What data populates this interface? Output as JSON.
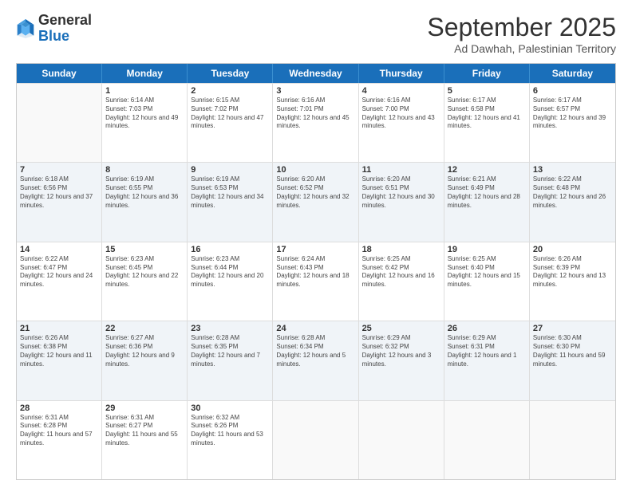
{
  "header": {
    "logo_general": "General",
    "logo_blue": "Blue",
    "month_title": "September 2025",
    "subtitle": "Ad Dawhah, Palestinian Territory"
  },
  "days": [
    "Sunday",
    "Monday",
    "Tuesday",
    "Wednesday",
    "Thursday",
    "Friday",
    "Saturday"
  ],
  "weeks": [
    [
      {
        "day": "",
        "sunrise": "",
        "sunset": "",
        "daylight": ""
      },
      {
        "day": "1",
        "sunrise": "6:14 AM",
        "sunset": "7:03 PM",
        "daylight": "12 hours and 49 minutes."
      },
      {
        "day": "2",
        "sunrise": "6:15 AM",
        "sunset": "7:02 PM",
        "daylight": "12 hours and 47 minutes."
      },
      {
        "day": "3",
        "sunrise": "6:16 AM",
        "sunset": "7:01 PM",
        "daylight": "12 hours and 45 minutes."
      },
      {
        "day": "4",
        "sunrise": "6:16 AM",
        "sunset": "7:00 PM",
        "daylight": "12 hours and 43 minutes."
      },
      {
        "day": "5",
        "sunrise": "6:17 AM",
        "sunset": "6:58 PM",
        "daylight": "12 hours and 41 minutes."
      },
      {
        "day": "6",
        "sunrise": "6:17 AM",
        "sunset": "6:57 PM",
        "daylight": "12 hours and 39 minutes."
      }
    ],
    [
      {
        "day": "7",
        "sunrise": "6:18 AM",
        "sunset": "6:56 PM",
        "daylight": "12 hours and 37 minutes."
      },
      {
        "day": "8",
        "sunrise": "6:19 AM",
        "sunset": "6:55 PM",
        "daylight": "12 hours and 36 minutes."
      },
      {
        "day": "9",
        "sunrise": "6:19 AM",
        "sunset": "6:53 PM",
        "daylight": "12 hours and 34 minutes."
      },
      {
        "day": "10",
        "sunrise": "6:20 AM",
        "sunset": "6:52 PM",
        "daylight": "12 hours and 32 minutes."
      },
      {
        "day": "11",
        "sunrise": "6:20 AM",
        "sunset": "6:51 PM",
        "daylight": "12 hours and 30 minutes."
      },
      {
        "day": "12",
        "sunrise": "6:21 AM",
        "sunset": "6:49 PM",
        "daylight": "12 hours and 28 minutes."
      },
      {
        "day": "13",
        "sunrise": "6:22 AM",
        "sunset": "6:48 PM",
        "daylight": "12 hours and 26 minutes."
      }
    ],
    [
      {
        "day": "14",
        "sunrise": "6:22 AM",
        "sunset": "6:47 PM",
        "daylight": "12 hours and 24 minutes."
      },
      {
        "day": "15",
        "sunrise": "6:23 AM",
        "sunset": "6:45 PM",
        "daylight": "12 hours and 22 minutes."
      },
      {
        "day": "16",
        "sunrise": "6:23 AM",
        "sunset": "6:44 PM",
        "daylight": "12 hours and 20 minutes."
      },
      {
        "day": "17",
        "sunrise": "6:24 AM",
        "sunset": "6:43 PM",
        "daylight": "12 hours and 18 minutes."
      },
      {
        "day": "18",
        "sunrise": "6:25 AM",
        "sunset": "6:42 PM",
        "daylight": "12 hours and 16 minutes."
      },
      {
        "day": "19",
        "sunrise": "6:25 AM",
        "sunset": "6:40 PM",
        "daylight": "12 hours and 15 minutes."
      },
      {
        "day": "20",
        "sunrise": "6:26 AM",
        "sunset": "6:39 PM",
        "daylight": "12 hours and 13 minutes."
      }
    ],
    [
      {
        "day": "21",
        "sunrise": "6:26 AM",
        "sunset": "6:38 PM",
        "daylight": "12 hours and 11 minutes."
      },
      {
        "day": "22",
        "sunrise": "6:27 AM",
        "sunset": "6:36 PM",
        "daylight": "12 hours and 9 minutes."
      },
      {
        "day": "23",
        "sunrise": "6:28 AM",
        "sunset": "6:35 PM",
        "daylight": "12 hours and 7 minutes."
      },
      {
        "day": "24",
        "sunrise": "6:28 AM",
        "sunset": "6:34 PM",
        "daylight": "12 hours and 5 minutes."
      },
      {
        "day": "25",
        "sunrise": "6:29 AM",
        "sunset": "6:32 PM",
        "daylight": "12 hours and 3 minutes."
      },
      {
        "day": "26",
        "sunrise": "6:29 AM",
        "sunset": "6:31 PM",
        "daylight": "12 hours and 1 minute."
      },
      {
        "day": "27",
        "sunrise": "6:30 AM",
        "sunset": "6:30 PM",
        "daylight": "11 hours and 59 minutes."
      }
    ],
    [
      {
        "day": "28",
        "sunrise": "6:31 AM",
        "sunset": "6:28 PM",
        "daylight": "11 hours and 57 minutes."
      },
      {
        "day": "29",
        "sunrise": "6:31 AM",
        "sunset": "6:27 PM",
        "daylight": "11 hours and 55 minutes."
      },
      {
        "day": "30",
        "sunrise": "6:32 AM",
        "sunset": "6:26 PM",
        "daylight": "11 hours and 53 minutes."
      },
      {
        "day": "",
        "sunrise": "",
        "sunset": "",
        "daylight": ""
      },
      {
        "day": "",
        "sunrise": "",
        "sunset": "",
        "daylight": ""
      },
      {
        "day": "",
        "sunrise": "",
        "sunset": "",
        "daylight": ""
      },
      {
        "day": "",
        "sunrise": "",
        "sunset": "",
        "daylight": ""
      }
    ]
  ]
}
